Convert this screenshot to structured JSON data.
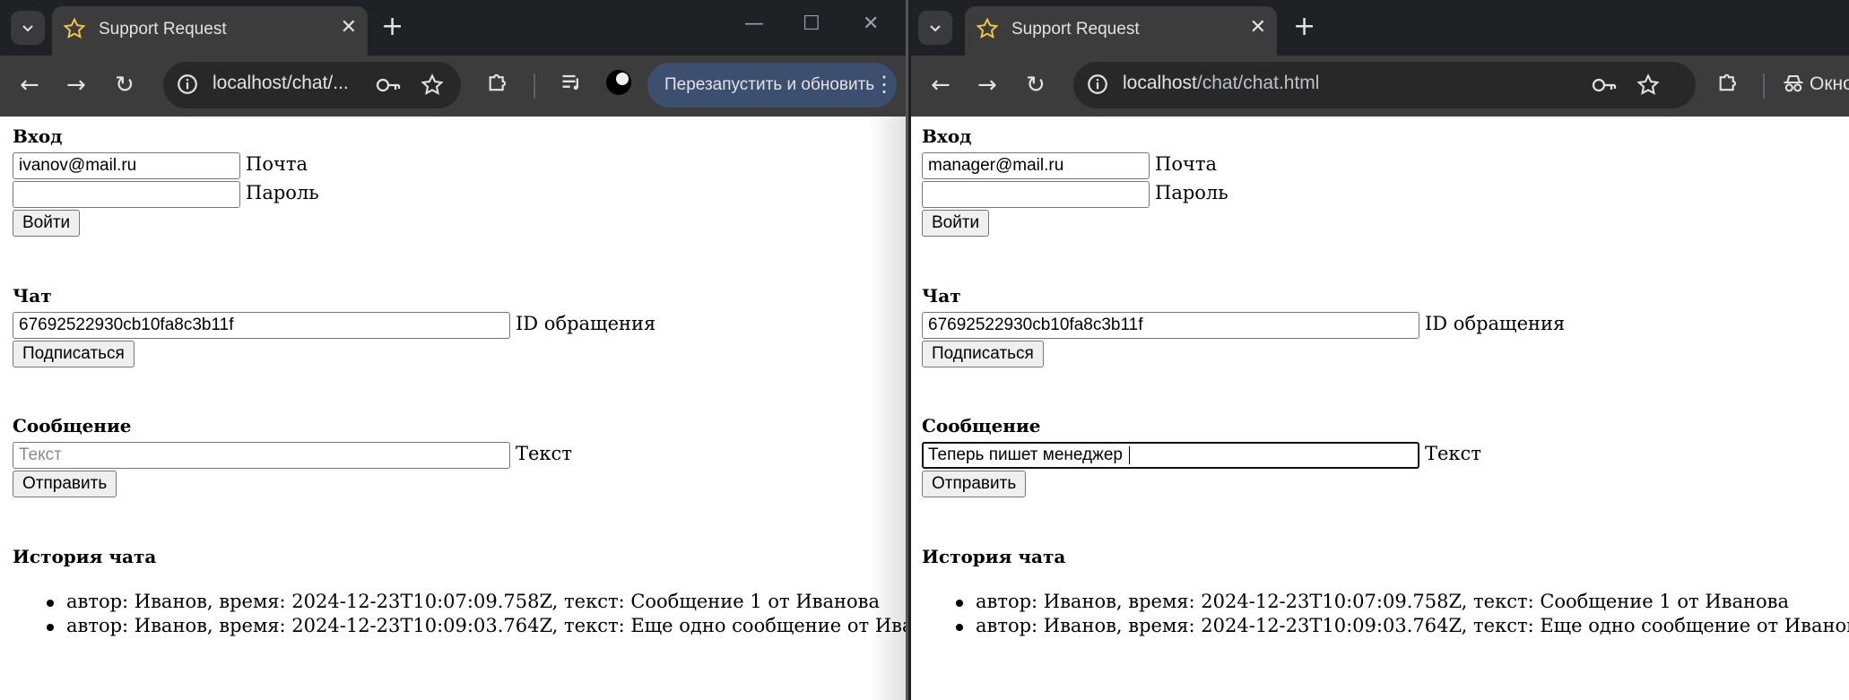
{
  "left_window": {
    "tab_title": "Support Request",
    "url": "localhost/chat/...",
    "relaunch_label": "Перезапустить и обновить",
    "login": {
      "title": "Вход",
      "email_value": "ivanov@mail.ru",
      "email_label": "Почта",
      "password_value": "",
      "password_label": "Пароль",
      "button": "Войти"
    },
    "chat": {
      "title": "Чат",
      "id_value": "67692522930cb10fa8c3b11f",
      "id_label": "ID обращения",
      "button": "Подписаться"
    },
    "message": {
      "title": "Сообщение",
      "value": "",
      "placeholder": "Текст",
      "label": "Текст",
      "button": "Отправить"
    },
    "history": {
      "title": "История чата",
      "items": [
        "автор: Иванов, время: 2024-12-23T10:07:09.758Z, текст: Сообщение 1 от Иванова",
        "автор: Иванов, время: 2024-12-23T10:09:03.764Z, текст: Еще одно сообщение от Иванова"
      ]
    }
  },
  "right_window": {
    "tab_title": "Support Request",
    "url_host": "localhost",
    "url_path": "/chat/chat.html",
    "toolbar_partial_label": "Окно",
    "login": {
      "title": "Вход",
      "email_value": "manager@mail.ru",
      "email_label": "Почта",
      "password_value": "",
      "password_label": "Пароль",
      "button": "Войти"
    },
    "chat": {
      "title": "Чат",
      "id_value": "67692522930cb10fa8c3b11f",
      "id_label": "ID обращения",
      "button": "Подписаться"
    },
    "message": {
      "title": "Сообщение",
      "value": "Теперь пишет менеджер ",
      "placeholder": "Текст",
      "label": "Текст",
      "button": "Отправить"
    },
    "history": {
      "title": "История чата",
      "items": [
        "автор: Иванов, время: 2024-12-23T10:07:09.758Z, текст: Сообщение 1 от Иванова",
        "автор: Иванов, время: 2024-12-23T10:09:03.764Z, текст: Еще одно сообщение от Иванова"
      ]
    }
  },
  "icons": {
    "tab_dropdown": "chevron-down-icon",
    "tab_favicon": "star-icon",
    "tab_close": "close-icon",
    "new_tab": "plus-icon",
    "back": "arrow-left-icon",
    "forward": "arrow-right-icon",
    "reload": "reload-icon",
    "site_info": "info-icon",
    "passwords": "key-icon",
    "bookmark": "star-icon",
    "extensions": "puzzle-icon",
    "media": "media-control-icon",
    "profile": "profile-icon",
    "menu": "kebab-menu-icon",
    "incognito": "incognito-icon"
  },
  "colors": {
    "tabbar_bg": "#202124",
    "toolbar_bg": "#3c3c3c",
    "omnibox_bg": "#282828",
    "relaunch_bg": "#3d4f6e",
    "favicon_star": "#f2c744",
    "page_bg": "#ffffff"
  }
}
